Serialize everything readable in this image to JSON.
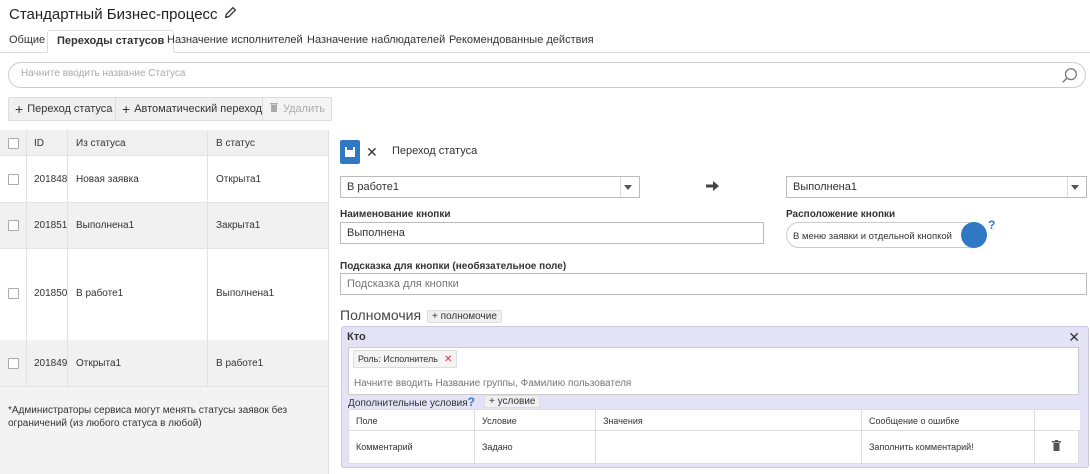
{
  "page_title": "Стандартный Бизнес-процесс",
  "tabs": [
    {
      "label": "Общие"
    },
    {
      "label": "Переходы статусов",
      "active": true
    },
    {
      "label": "Назначение исполнителей"
    },
    {
      "label": "Назначение наблюдателей"
    },
    {
      "label": "Рекомендованные действия"
    }
  ],
  "search": {
    "placeholder": "Начните вводить название Статуса"
  },
  "toolbar": {
    "add_transition": "Переход статуса",
    "auto_transition": "Автоматический переход",
    "delete": "Удалить"
  },
  "table": {
    "headers": {
      "id": "ID",
      "from": "Из статуса",
      "to": "В статус"
    },
    "rows": [
      {
        "id": "201848",
        "from": "Новая заявка",
        "to": "Открыта1"
      },
      {
        "id": "201851",
        "from": "Выполнена1",
        "to": "Закрыта1"
      },
      {
        "id": "201850",
        "from": "В работе1",
        "to": "Выполнена1"
      },
      {
        "id": "201849",
        "from": "Открыта1",
        "to": "В работе1"
      }
    ],
    "footnote": "*Администраторы сервиса могут менять статусы заявок без ограничений (из любого статуса в любой)"
  },
  "editor": {
    "header": "Переход статуса",
    "from_status": "В работе1",
    "to_status": "Выполнена1",
    "button_name_label": "Наименование кнопки",
    "button_name_value": "Выполнена",
    "button_position_label": "Расположение кнопки",
    "button_position_value": "В меню заявки и отдельной кнопкой",
    "help_mark": "?",
    "hint_label": "Подсказка для кнопки (необязательное поле)",
    "hint_placeholder": "Подсказка для кнопки",
    "permissions_title": "Полномочия",
    "add_permission": "полномочие",
    "who": {
      "title": "Кто",
      "chip": "Роль: Исполнитель",
      "placeholder": "Начните вводить Название группы, Фамилию пользователя",
      "extra_conditions": "Дополнительные условия",
      "add_condition": "условие",
      "cond_headers": {
        "field": "Поле",
        "condition": "Условие",
        "values": "Значения",
        "error": "Сообщение о ошибке"
      },
      "cond_row": {
        "field": "Комментарий",
        "condition": "Задано",
        "values": "",
        "error": "Заполнить комментарий!"
      }
    }
  },
  "colors": {
    "accent": "#2f78c4",
    "panel": "#e3e3f5"
  }
}
